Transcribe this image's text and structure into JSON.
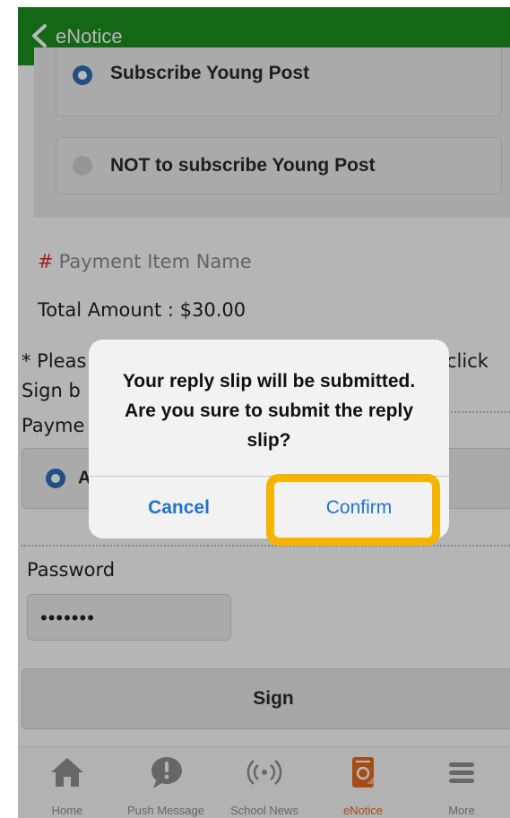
{
  "header": {
    "title": "eNotice"
  },
  "options": [
    {
      "label": "Subscribe Young Post",
      "selected": true
    },
    {
      "label": "NOT to subscribe Young Post",
      "selected": false
    }
  ],
  "payment": {
    "item_name": "Payment Item Name",
    "total_amount": "Total Amount : $30.00",
    "note_line1_start": "* Pleas",
    "note_line1_end": "click",
    "note_line2_start": "Sign b",
    "method_label_start": "Payme",
    "method_option_start": "A"
  },
  "password": {
    "label": "Password",
    "value": "•••••••"
  },
  "sign_button": "Sign",
  "dialog": {
    "message": "Your reply slip will be submitted. Are you sure to submit the reply slip?",
    "cancel": "Cancel",
    "confirm": "Confirm"
  },
  "tabbar": [
    {
      "label": "Home",
      "icon": "home-icon"
    },
    {
      "label": "Push Message",
      "icon": "push-message-icon"
    },
    {
      "label": "School News",
      "icon": "broadcast-icon"
    },
    {
      "label": "eNotice",
      "icon": "enotice-icon",
      "active": true
    },
    {
      "label": "More",
      "icon": "menu-icon"
    }
  ],
  "colors": {
    "header_green": "#1c8f1c",
    "radio_blue": "#2f6eb5",
    "active_tab": "#e56b1f",
    "highlight": "#f5b400",
    "dialog_button": "#1e73d6"
  }
}
